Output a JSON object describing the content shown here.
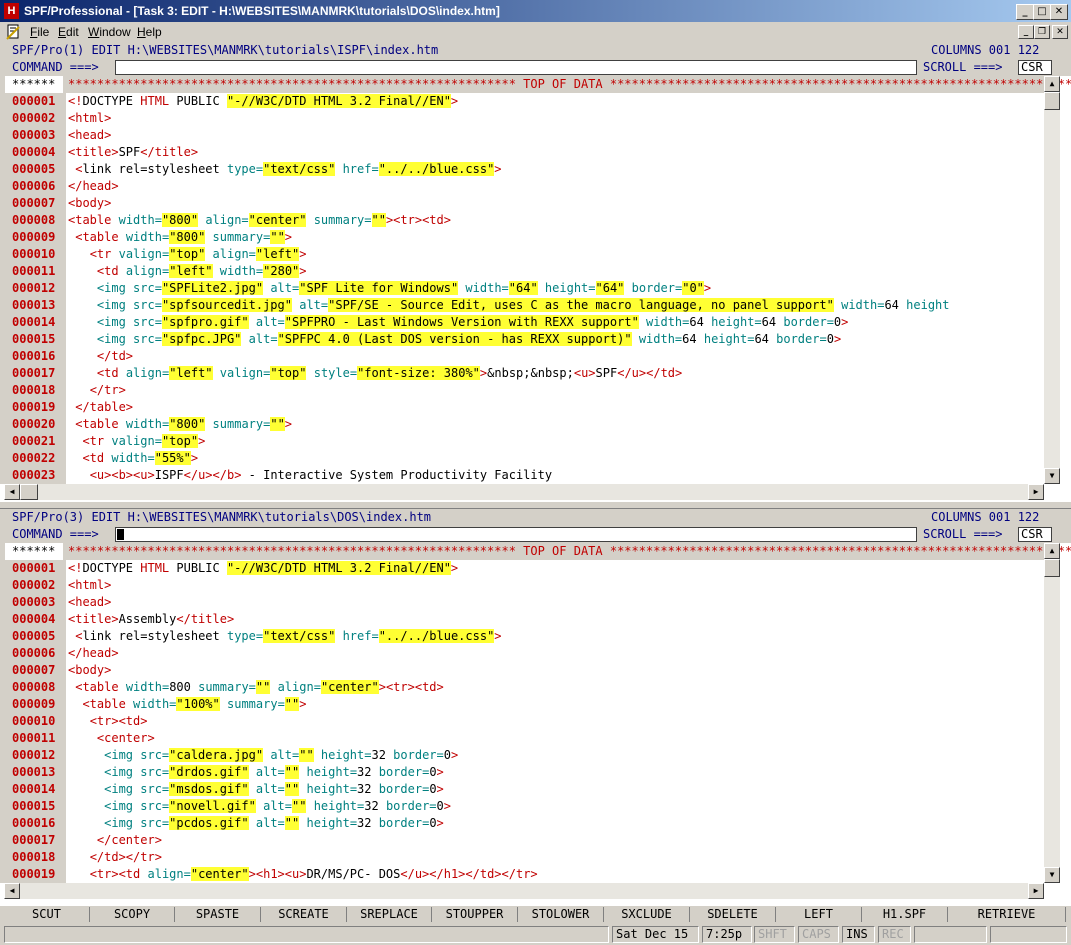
{
  "window": {
    "title": "SPF/Professional - [Task 3: EDIT - H:\\WEBSITES\\MANMRK\\tutorials\\DOS\\index.htm]",
    "app_icon": "H"
  },
  "menu": [
    "File",
    "Edit",
    "Window",
    "Help"
  ],
  "pane1": {
    "header": "SPF/Pro(1) EDIT H:\\WEBSITES\\MANMRK\\tutorials\\ISPF\\index.htm",
    "columns": "COLUMNS 001 122",
    "command_label": "COMMAND ===>",
    "command_value": "",
    "scroll_label": "SCROLL ===>",
    "scroll_value": "CSR",
    "top_marker": "******",
    "top_of_data": "************************************************************** TOP OF DATA ****************************************************************",
    "lines": [
      {
        "n": "000001",
        "html": "<span class=\"t\">&lt;!</span>DOCTYPE <span class=\"k\">HTML</span> PUBLIC <span class=\"s\">\"-//W3C/DTD HTML 3.2 Final//EN\"</span><span class=\"t\">&gt;</span>"
      },
      {
        "n": "000002",
        "html": "<span class=\"t\">&lt;html&gt;</span>"
      },
      {
        "n": "000003",
        "html": "<span class=\"t\">&lt;head&gt;</span>"
      },
      {
        "n": "000004",
        "html": "<span class=\"t\">&lt;title&gt;</span>SPF<span class=\"t\">&lt;/title&gt;</span>"
      },
      {
        "n": "000005",
        "html": " <span class=\"t\">&lt;</span>link rel=stylesheet <span class=\"a\">type=</span><span class=\"s\">\"text/css\"</span> <span class=\"a\">href=</span><span class=\"s\">\"../../blue.css\"</span><span class=\"t\">&gt;</span>"
      },
      {
        "n": "000006",
        "html": "<span class=\"t\">&lt;/head&gt;</span>"
      },
      {
        "n": "000007",
        "html": "<span class=\"t\">&lt;body&gt;</span>"
      },
      {
        "n": "000008",
        "html": "<span class=\"t\">&lt;table</span> <span class=\"a\">width=</span><span class=\"s\">\"800\"</span> <span class=\"a\">align=</span><span class=\"s\">\"center\"</span> <span class=\"a\">summary=</span><span class=\"s\">\"\"</span><span class=\"t\">&gt;&lt;tr&gt;&lt;td&gt;</span>"
      },
      {
        "n": "000009",
        "html": " <span class=\"t\">&lt;table</span> <span class=\"a\">width=</span><span class=\"s\">\"800\"</span> <span class=\"a\">summary=</span><span class=\"s\">\"\"</span><span class=\"t\">&gt;</span>"
      },
      {
        "n": "000010",
        "html": "   <span class=\"t\">&lt;tr</span> <span class=\"a\">valign=</span><span class=\"s\">\"top\"</span> <span class=\"a\">align=</span><span class=\"s\">\"left\"</span><span class=\"t\">&gt;</span>"
      },
      {
        "n": "000011",
        "html": "    <span class=\"t\">&lt;td</span> <span class=\"a\">align=</span><span class=\"s\">\"left\"</span> <span class=\"a\">width=</span><span class=\"s\">\"280\"</span><span class=\"t\">&gt;</span>"
      },
      {
        "n": "000012",
        "html": "    <span class=\"a\">&lt;img src=</span><span class=\"s\">\"SPFLite2.jpg\"</span> <span class=\"a\">alt=</span><span class=\"s\">\"SPF Lite for Windows\"</span> <span class=\"a\">width=</span><span class=\"s\">\"64\"</span> <span class=\"a\">height=</span><span class=\"s\">\"64\"</span> <span class=\"a\">border=</span><span class=\"s\">\"0\"</span><span class=\"t\">&gt;</span>"
      },
      {
        "n": "000013",
        "html": "    <span class=\"a\">&lt;img src=</span><span class=\"s\">\"spfsourcedit.jpg\"</span> <span class=\"a\">alt=</span><span class=\"s\">\"SPF/SE - Source Edit, uses C as the macro language, no panel support\"</span> <span class=\"a\">width=</span>64 <span class=\"a\">height</span>"
      },
      {
        "n": "000014",
        "html": "    <span class=\"a\">&lt;img src=</span><span class=\"s\">\"spfpro.gif\"</span> <span class=\"a\">alt=</span><span class=\"s\">\"SPFPRO - Last Windows Version with REXX support\"</span> <span class=\"a\">width=</span>64 <span class=\"a\">height=</span>64 <span class=\"a\">border=</span>0<span class=\"t\">&gt;</span>"
      },
      {
        "n": "000015",
        "html": "    <span class=\"a\">&lt;img src=</span><span class=\"s\">\"spfpc.JPG\"</span> <span class=\"a\">alt=</span><span class=\"s\">\"SPFPC 4.0 (Last DOS version - has REXX support)\"</span> <span class=\"a\">width=</span>64 <span class=\"a\">height=</span>64 <span class=\"a\">border=</span>0<span class=\"t\">&gt;</span>"
      },
      {
        "n": "000016",
        "html": "    <span class=\"t\">&lt;/td&gt;</span>"
      },
      {
        "n": "000017",
        "html": "    <span class=\"t\">&lt;td</span> <span class=\"a\">align=</span><span class=\"s\">\"left\"</span> <span class=\"a\">valign=</span><span class=\"s\">\"top\"</span> <span class=\"a\">style=</span><span class=\"s\">\"font-size: 380%\"</span><span class=\"t\">&gt;</span>&amp;nbsp;&amp;nbsp;<span class=\"t\">&lt;u&gt;</span>SPF<span class=\"t\">&lt;/u&gt;&lt;/td&gt;</span>"
      },
      {
        "n": "000018",
        "html": "   <span class=\"t\">&lt;/tr&gt;</span>"
      },
      {
        "n": "000019",
        "html": " <span class=\"t\">&lt;/table&gt;</span>"
      },
      {
        "n": "000020",
        "html": " <span class=\"t\">&lt;table</span> <span class=\"a\">width=</span><span class=\"s\">\"800\"</span> <span class=\"a\">summary=</span><span class=\"s\">\"\"</span><span class=\"t\">&gt;</span>"
      },
      {
        "n": "000021",
        "html": "  <span class=\"t\">&lt;tr</span> <span class=\"a\">valign=</span><span class=\"s\">\"top\"</span><span class=\"t\">&gt;</span>"
      },
      {
        "n": "000022",
        "html": "  <span class=\"t\">&lt;td</span> <span class=\"a\">width=</span><span class=\"s\">\"55%\"</span><span class=\"t\">&gt;</span>"
      },
      {
        "n": "000023",
        "html": "   <span class=\"t\">&lt;u&gt;&lt;b&gt;&lt;u&gt;</span>ISPF<span class=\"t\">&lt;/u&gt;&lt;/b&gt;</span> - Interactive System Productivity Facility"
      }
    ]
  },
  "pane2": {
    "header": "SPF/Pro(3) EDIT H:\\WEBSITES\\MANMRK\\tutorials\\DOS\\index.htm",
    "columns": "COLUMNS 001 122",
    "command_label": "COMMAND ===>",
    "command_value": "",
    "scroll_label": "SCROLL ===>",
    "scroll_value": "CSR",
    "top_marker": "******",
    "top_of_data": "************************************************************** TOP OF DATA ****************************************************************",
    "lines": [
      {
        "n": "000001",
        "html": "<span class=\"t\">&lt;!</span>DOCTYPE <span class=\"k\">HTML</span> PUBLIC <span class=\"s\">\"-//W3C/DTD HTML 3.2 Final//EN\"</span><span class=\"t\">&gt;</span>"
      },
      {
        "n": "000002",
        "html": "<span class=\"t\">&lt;html&gt;</span>"
      },
      {
        "n": "000003",
        "html": "<span class=\"t\">&lt;head&gt;</span>"
      },
      {
        "n": "000004",
        "html": "<span class=\"t\">&lt;title&gt;</span>Assembly<span class=\"t\">&lt;/title&gt;</span>"
      },
      {
        "n": "000005",
        "html": " <span class=\"t\">&lt;</span>link rel=stylesheet <span class=\"a\">type=</span><span class=\"s\">\"text/css\"</span> <span class=\"a\">href=</span><span class=\"s\">\"../../blue.css\"</span><span class=\"t\">&gt;</span>"
      },
      {
        "n": "000006",
        "html": "<span class=\"t\">&lt;/head&gt;</span>"
      },
      {
        "n": "000007",
        "html": "<span class=\"t\">&lt;body&gt;</span>"
      },
      {
        "n": "000008",
        "html": " <span class=\"t\">&lt;table</span> <span class=\"a\">width=</span>800 <span class=\"a\">summary=</span><span class=\"s\">\"\"</span> <span class=\"a\">align=</span><span class=\"s\">\"center\"</span><span class=\"t\">&gt;&lt;tr&gt;&lt;td&gt;</span>"
      },
      {
        "n": "000009",
        "html": "  <span class=\"t\">&lt;table</span> <span class=\"a\">width=</span><span class=\"s\">\"100%\"</span> <span class=\"a\">summary=</span><span class=\"s\">\"\"</span><span class=\"t\">&gt;</span>"
      },
      {
        "n": "000010",
        "html": "   <span class=\"t\">&lt;tr&gt;&lt;td&gt;</span>"
      },
      {
        "n": "000011",
        "html": "    <span class=\"t\">&lt;center&gt;</span>"
      },
      {
        "n": "000012",
        "html": "     <span class=\"a\">&lt;img src=</span><span class=\"s\">\"caldera.jpg\"</span> <span class=\"a\">alt=</span><span class=\"s\">\"\"</span> <span class=\"a\">height=</span>32 <span class=\"a\">border=</span>0<span class=\"t\">&gt;</span>"
      },
      {
        "n": "000013",
        "html": "     <span class=\"a\">&lt;img src=</span><span class=\"s\">\"drdos.gif\"</span> <span class=\"a\">alt=</span><span class=\"s\">\"\"</span> <span class=\"a\">height=</span>32 <span class=\"a\">border=</span>0<span class=\"t\">&gt;</span>"
      },
      {
        "n": "000014",
        "html": "     <span class=\"a\">&lt;img src=</span><span class=\"s\">\"msdos.gif\"</span> <span class=\"a\">alt=</span><span class=\"s\">\"\"</span> <span class=\"a\">height=</span>32 <span class=\"a\">border=</span>0<span class=\"t\">&gt;</span>"
      },
      {
        "n": "000015",
        "html": "     <span class=\"a\">&lt;img src=</span><span class=\"s\">\"novell.gif\"</span> <span class=\"a\">alt=</span><span class=\"s\">\"\"</span> <span class=\"a\">height=</span>32 <span class=\"a\">border=</span>0<span class=\"t\">&gt;</span>"
      },
      {
        "n": "000016",
        "html": "     <span class=\"a\">&lt;img src=</span><span class=\"s\">\"pcdos.gif\"</span> <span class=\"a\">alt=</span><span class=\"s\">\"\"</span> <span class=\"a\">height=</span>32 <span class=\"a\">border=</span>0<span class=\"t\">&gt;</span>"
      },
      {
        "n": "000017",
        "html": "    <span class=\"t\">&lt;/center&gt;</span>"
      },
      {
        "n": "000018",
        "html": "   <span class=\"t\">&lt;/td&gt;&lt;/tr&gt;</span>"
      },
      {
        "n": "000019",
        "html": "   <span class=\"t\">&lt;tr&gt;&lt;td</span> <span class=\"a\">align=</span><span class=\"s\">\"center\"</span><span class=\"t\">&gt;&lt;h1&gt;&lt;u&gt;</span>DR/MS/PC- DOS<span class=\"t\">&lt;/u&gt;&lt;/h1&gt;&lt;/td&gt;&lt;/tr&gt;</span>"
      }
    ]
  },
  "function_keys": [
    "SCUT",
    "SCOPY",
    "SPASTE",
    "SCREATE",
    "SREPLACE",
    "STOUPPER",
    "STOLOWER",
    "SXCLUDE",
    "SDELETE",
    "LEFT",
    "H1.SPF",
    "RETRIEVE"
  ],
  "status": {
    "date": "Sat Dec 15",
    "time": "7:25p",
    "shft": "SHFT",
    "caps": "CAPS",
    "ins": "INS",
    "rec": "REC"
  },
  "colors": {
    "title_bar": "#0a246a",
    "header_text": "#000080",
    "line_number": "#c00000",
    "tag": "#c00000",
    "attribute": "#008080",
    "string_highlight": "#ffff33"
  }
}
